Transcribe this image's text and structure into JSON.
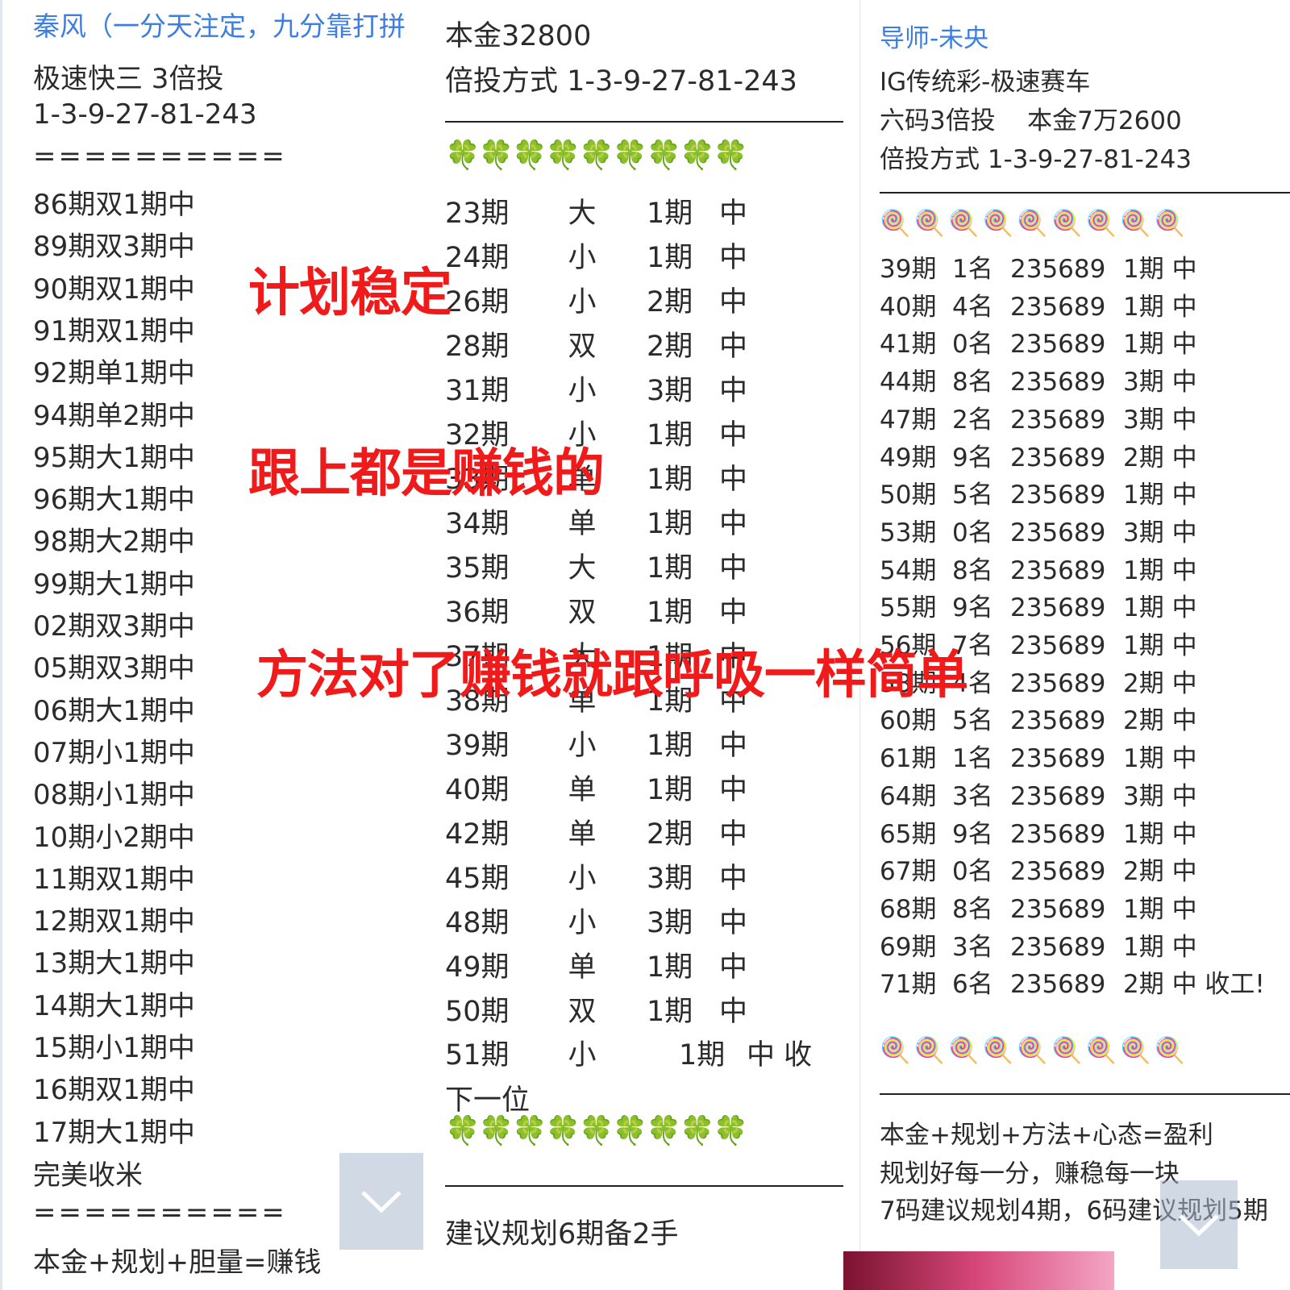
{
  "left": {
    "title": "秦风（一分天注定，九分靠打拼",
    "game": "极速快三 3倍投",
    "sequence": "1-3-9-27-81-243",
    "divider": "==========",
    "records": [
      [
        "86期",
        "双",
        "1期",
        "中"
      ],
      [
        "89期",
        "双",
        "3期",
        "中"
      ],
      [
        "90期",
        "双",
        "1期",
        "中"
      ],
      [
        "91期",
        "双",
        "1期",
        "中"
      ],
      [
        "92期",
        "单",
        "1期",
        "中"
      ],
      [
        "94期",
        "单",
        "2期",
        "中"
      ],
      [
        "95期",
        "大",
        "1期",
        "中"
      ],
      [
        "96期",
        "大",
        "1期",
        "中"
      ],
      [
        "98期",
        "大",
        "2期",
        "中"
      ],
      [
        "99期",
        "大",
        "1期",
        "中"
      ],
      [
        "02期",
        "双",
        "3期",
        "中"
      ],
      [
        "05期",
        "双",
        "3期",
        "中"
      ],
      [
        "06期",
        "大",
        "1期",
        "中"
      ],
      [
        "07期",
        "小",
        "1期",
        "中"
      ],
      [
        "08期",
        "小",
        "1期",
        "中"
      ],
      [
        "10期",
        "小",
        "2期",
        "中"
      ],
      [
        "11期",
        "双",
        "1期",
        "中"
      ],
      [
        "12期",
        "双",
        "1期",
        "中"
      ],
      [
        "13期",
        "大",
        "1期",
        "中"
      ],
      [
        "14期",
        "大",
        "1期",
        "中"
      ],
      [
        "15期",
        "小",
        "1期",
        "中"
      ],
      [
        "16期",
        "双",
        "1期",
        "中"
      ],
      [
        "17期",
        "大",
        "1期",
        "中"
      ]
    ],
    "closing": "完美收米",
    "divider2": "==========",
    "footer": "本金+规划+胆量=赚钱"
  },
  "middle": {
    "capital": "本金32800",
    "method": "倍投方式 1-3-9-27-81-243",
    "clovers": "🍀🍀🍀🍀🍀🍀🍀🍀🍀",
    "records": [
      [
        "23期",
        "大",
        "1期",
        "中"
      ],
      [
        "24期",
        "小",
        "1期",
        "中"
      ],
      [
        "26期",
        "小",
        "2期",
        "中"
      ],
      [
        "28期",
        "双",
        "2期",
        "中"
      ],
      [
        "31期",
        "小",
        "3期",
        "中"
      ],
      [
        "32期",
        "小",
        "1期",
        "中"
      ],
      [
        "33期",
        "单",
        "1期",
        "中"
      ],
      [
        "34期",
        "单",
        "1期",
        "中"
      ],
      [
        "35期",
        "大",
        "1期",
        "中"
      ],
      [
        "36期",
        "双",
        "1期",
        "中"
      ],
      [
        "37期",
        "大",
        "1期",
        "中"
      ],
      [
        "38期",
        "单",
        "1期",
        "中"
      ],
      [
        "39期",
        "小",
        "1期",
        "中"
      ],
      [
        "40期",
        "单",
        "1期",
        "中"
      ],
      [
        "42期",
        "单",
        "2期",
        "中"
      ],
      [
        "45期",
        "小",
        "3期",
        "中"
      ],
      [
        "48期",
        "小",
        "3期",
        "中"
      ],
      [
        "49期",
        "单",
        "1期",
        "中"
      ],
      [
        "50期",
        "双",
        "1期",
        "中"
      ]
    ],
    "last_record": [
      "51期",
      "小",
      "1期",
      "中 收"
    ],
    "next": "下一位",
    "clovers2": "🍀🍀🍀🍀🍀🍀🍀🍀🍀",
    "advice": "建议规划6期备2手"
  },
  "right": {
    "mentor": "导师-未央",
    "game": "IG传统彩-极速赛车",
    "plan": "六码3倍投    本金7万2600",
    "method": "倍投方式 1-3-9-27-81-243",
    "lollies": "🍭🍭🍭🍭🍭🍭🍭🍭🍭",
    "records": [
      [
        "39期",
        "1名",
        "235689",
        "1期 中"
      ],
      [
        "40期",
        "4名",
        "235689",
        "1期 中"
      ],
      [
        "41期",
        "0名",
        "235689",
        "1期 中"
      ],
      [
        "44期",
        "8名",
        "235689",
        "3期 中"
      ],
      [
        "47期",
        "2名",
        "235689",
        "3期 中"
      ],
      [
        "49期",
        "9名",
        "235689",
        "2期 中"
      ],
      [
        "50期",
        "5名",
        "235689",
        "1期 中"
      ],
      [
        "53期",
        "0名",
        "235689",
        "3期 中"
      ],
      [
        "54期",
        "8名",
        "235689",
        "1期 中"
      ],
      [
        "55期",
        "9名",
        "235689",
        "1期 中"
      ],
      [
        "56期",
        "7名",
        "235689",
        "1期 中"
      ],
      [
        "58期",
        "4名",
        "235689",
        "2期 中"
      ],
      [
        "60期",
        "5名",
        "235689",
        "2期 中"
      ],
      [
        "61期",
        "1名",
        "235689",
        "1期 中"
      ],
      [
        "64期",
        "3名",
        "235689",
        "3期 中"
      ],
      [
        "65期",
        "9名",
        "235689",
        "1期 中"
      ],
      [
        "67期",
        "0名",
        "235689",
        "2期 中"
      ],
      [
        "68期",
        "8名",
        "235689",
        "1期 中"
      ],
      [
        "69期",
        "3名",
        "235689",
        "1期 中"
      ],
      [
        "71期",
        "6名",
        "235689",
        "2期 中 收工!"
      ]
    ],
    "lollies2": "🍭🍭🍭🍭🍭🍭🍭🍭🍭",
    "formula": "本金+规划+方法+心态=盈利",
    "motto": "规划好每一分，赚稳每一块",
    "suggestion": "7码建议规划4期，6码建议规划5期"
  },
  "overlay": {
    "line1": "计划稳定",
    "line2": "跟上都是赚钱的",
    "line3": "方法对了赚钱就跟呼吸一样简单"
  },
  "colors": {
    "link": "#3d7fe0",
    "overlay_red": "#f01a1a",
    "clover_green": "#2f9e2f"
  }
}
